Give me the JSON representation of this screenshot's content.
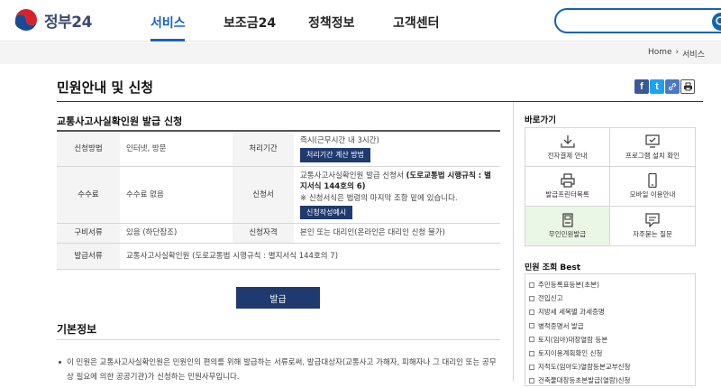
{
  "header": {
    "logo_text": "정부24",
    "nav": [
      "서비스",
      "보조금24",
      "정책정보",
      "고객센터"
    ]
  },
  "breadcrumb": [
    "Home",
    "서비스"
  ],
  "page_title": "민원안내 및 신청",
  "share_icons": [
    "facebook-icon",
    "twitter-icon",
    "link-icon",
    "print-icon"
  ],
  "section_title": "교통사고사실확인원 발급 신청",
  "table": {
    "method_label": "신청방법",
    "method_value": "인터넷, 방문",
    "period_label": "처리기간",
    "period_value": "즉시(근무시간 내 3시간)",
    "period_button": "처리기간 계산 방법",
    "fee_label": "수수료",
    "fee_value": "수수료 없음",
    "form_label": "신청서",
    "form_value_prefix": "교통사고사실확인원 발급 신청서 ",
    "form_value_bold": "(도로교통법 시행규칙 : 별지서식 144호의 6)",
    "form_note": "※ 신청서식은 법령의 마지막 조항 밑에 있습니다.",
    "form_button": "신청작성예시",
    "docs_label": "구비서류",
    "docs_value": "있음 (하단참조)",
    "qual_label": "신청자격",
    "qual_value": "본인 또는 대리인(온라인은 대리인 신청 불가)",
    "issue_label": "발급서류",
    "issue_value": "교통사고사실확인원 (도로교통법 시행규칙 : 별지서식 144호의 7)"
  },
  "issue_button": "발급",
  "basic_title": "기본정보",
  "basic_text": "이 민원은 교통사고사실확인원은 민원인의 편의를 위해 발급하는 서류로써, 발급대상자(교통사고 가해자, 피해자나 그 대리인 또는 공무상 필요에 의한 공공기관)가 신청하는 민원사무입니다.",
  "quick": {
    "title": "바로가기",
    "items": [
      {
        "label": "전자결제 안내",
        "icon": "download-icon"
      },
      {
        "label": "프로그램 설치 확인",
        "icon": "monitor-check-icon"
      },
      {
        "label": "발급프린터목록",
        "icon": "printer-icon"
      },
      {
        "label": "모바일 이용안내",
        "icon": "mobile-icon"
      },
      {
        "label": "무인민원발급",
        "icon": "kiosk-icon"
      },
      {
        "label": "자주묻는 질문",
        "icon": "faq-icon"
      }
    ]
  },
  "best": {
    "title": "민원 조회 Best",
    "items": [
      "주민등록표등본(초본)",
      "전입신고",
      "지방세 세목별 과세증명",
      "병적증명서 발급",
      "토지(임야)대장열람 등본",
      "토지이용계획확인 신청",
      "지적도(임야도)열람등본교부신청",
      "건축물대장등초본발급(열람)신청"
    ]
  }
}
